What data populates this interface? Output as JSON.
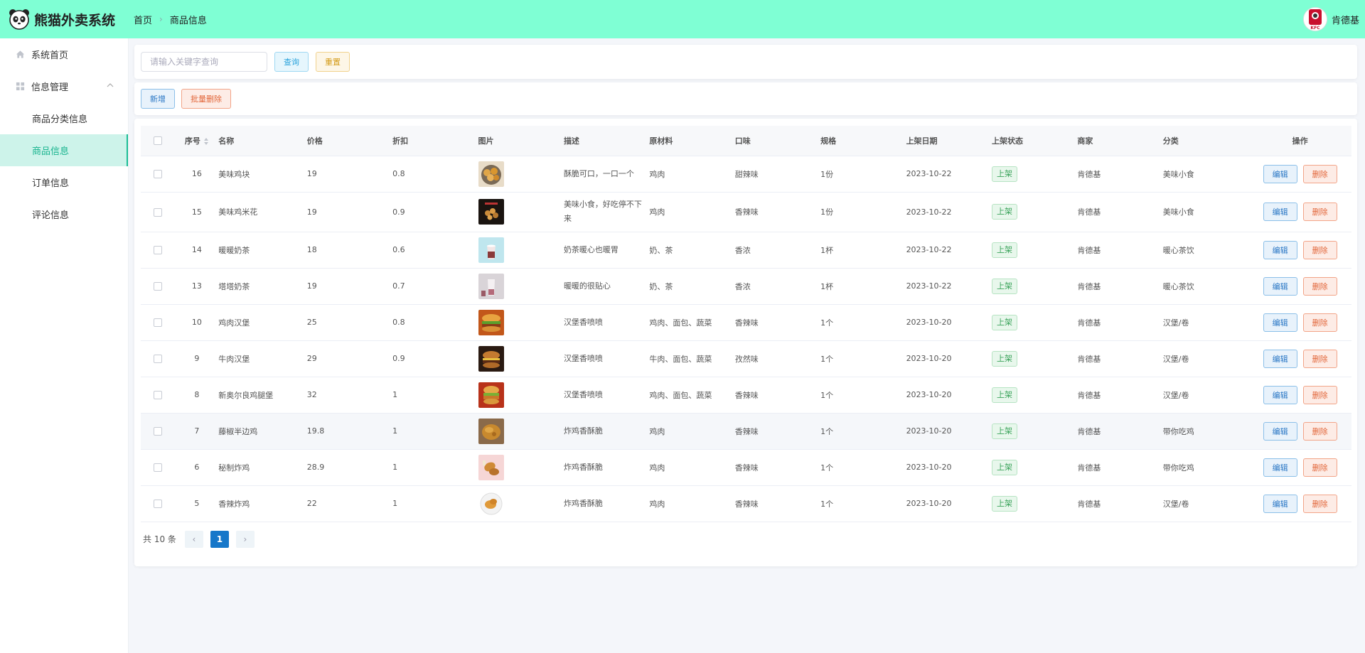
{
  "app": {
    "title": "熊猫外卖系统"
  },
  "breadcrumb": {
    "home": "首页",
    "current": "商品信息"
  },
  "user": {
    "name": "肯德基",
    "avatar_text": "KFC"
  },
  "sidebar": {
    "home": "系统首页",
    "group": "信息管理",
    "items": [
      {
        "label": "商品分类信息"
      },
      {
        "label": "商品信息"
      },
      {
        "label": "订单信息"
      },
      {
        "label": "评论信息"
      }
    ]
  },
  "search": {
    "placeholder": "请输入关键字查询",
    "query_label": "查询",
    "reset_label": "重置"
  },
  "actions": {
    "add_label": "新增",
    "batch_delete_label": "批量删除"
  },
  "table": {
    "headers": [
      "序号",
      "名称",
      "价格",
      "折扣",
      "图片",
      "描述",
      "原材料",
      "口味",
      "规格",
      "上架日期",
      "上架状态",
      "商家",
      "分类",
      "操作"
    ],
    "edit_label": "编辑",
    "delete_label": "删除",
    "rows": [
      {
        "id": "16",
        "name": "美味鸡块",
        "price": "19",
        "discount": "0.8",
        "desc": "酥脆可口，一口一个",
        "material": "鸡肉",
        "taste": "甜辣味",
        "spec": "1份",
        "date": "2023-10-22",
        "status": "上架",
        "merchant": "肯德基",
        "category": "美味小食"
      },
      {
        "id": "15",
        "name": "美味鸡米花",
        "price": "19",
        "discount": "0.9",
        "desc": "美味小食，好吃停不下来",
        "material": "鸡肉",
        "taste": "香辣味",
        "spec": "1份",
        "date": "2023-10-22",
        "status": "上架",
        "merchant": "肯德基",
        "category": "美味小食"
      },
      {
        "id": "14",
        "name": "暖暖奶茶",
        "price": "18",
        "discount": "0.6",
        "desc": "奶茶暖心也暖胃",
        "material": "奶、茶",
        "taste": "香浓",
        "spec": "1杯",
        "date": "2023-10-22",
        "status": "上架",
        "merchant": "肯德基",
        "category": "暖心茶饮"
      },
      {
        "id": "13",
        "name": "塔塔奶茶",
        "price": "19",
        "discount": "0.7",
        "desc": "暖暖的很贴心",
        "material": "奶、茶",
        "taste": "香浓",
        "spec": "1杯",
        "date": "2023-10-22",
        "status": "上架",
        "merchant": "肯德基",
        "category": "暖心茶饮"
      },
      {
        "id": "10",
        "name": "鸡肉汉堡",
        "price": "25",
        "discount": "0.8",
        "desc": "汉堡香喷喷",
        "material": "鸡肉、面包、蔬菜",
        "taste": "香辣味",
        "spec": "1个",
        "date": "2023-10-20",
        "status": "上架",
        "merchant": "肯德基",
        "category": "汉堡/卷"
      },
      {
        "id": "9",
        "name": "牛肉汉堡",
        "price": "29",
        "discount": "0.9",
        "desc": "汉堡香喷喷",
        "material": "牛肉、面包、蔬菜",
        "taste": "孜然味",
        "spec": "1个",
        "date": "2023-10-20",
        "status": "上架",
        "merchant": "肯德基",
        "category": "汉堡/卷"
      },
      {
        "id": "8",
        "name": "新奥尔良鸡腿堡",
        "price": "32",
        "discount": "1",
        "desc": "汉堡香喷喷",
        "material": "鸡肉、面包、蔬菜",
        "taste": "香辣味",
        "spec": "1个",
        "date": "2023-10-20",
        "status": "上架",
        "merchant": "肯德基",
        "category": "汉堡/卷"
      },
      {
        "id": "7",
        "name": "藤椒半边鸡",
        "price": "19.8",
        "discount": "1",
        "desc": "炸鸡香酥脆",
        "material": "鸡肉",
        "taste": "香辣味",
        "spec": "1个",
        "date": "2023-10-20",
        "status": "上架",
        "merchant": "肯德基",
        "category": "带你吃鸡"
      },
      {
        "id": "6",
        "name": "秘制炸鸡",
        "price": "28.9",
        "discount": "1",
        "desc": "炸鸡香酥脆",
        "material": "鸡肉",
        "taste": "香辣味",
        "spec": "1个",
        "date": "2023-10-20",
        "status": "上架",
        "merchant": "肯德基",
        "category": "带你吃鸡"
      },
      {
        "id": "5",
        "name": "香辣炸鸡",
        "price": "22",
        "discount": "1",
        "desc": "炸鸡香酥脆",
        "material": "鸡肉",
        "taste": "香辣味",
        "spec": "1个",
        "date": "2023-10-20",
        "status": "上架",
        "merchant": "肯德基",
        "category": "汉堡/卷"
      }
    ]
  },
  "pagination": {
    "total_text": "共 10 条",
    "current": "1",
    "prev": "‹",
    "next": "›"
  },
  "colors": {
    "header_bg": "#7fffd4",
    "active_nav": "#17b38e",
    "primary": "#1677c9",
    "success_tag": "#3aa35a"
  }
}
